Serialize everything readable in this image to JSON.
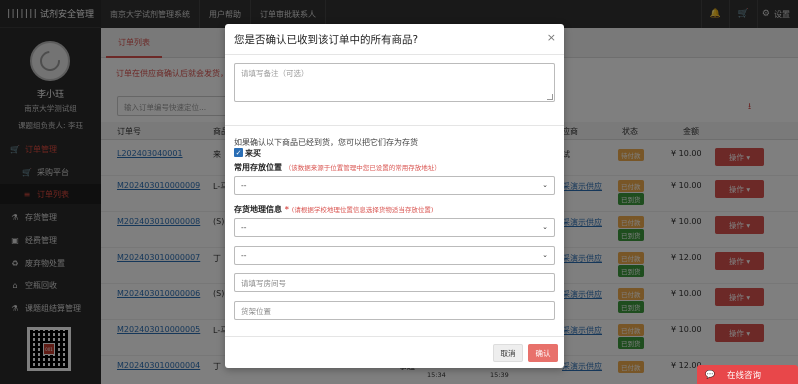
{
  "app": {
    "logo_glyph": "|||||||",
    "title": "试剂安全管理"
  },
  "user": {
    "name": "李小珏",
    "group": "南京大学测试组",
    "role": "课题组负责人: 李珏"
  },
  "sidebar": {
    "items": [
      {
        "icon": "cart-icon",
        "glyph": "🛒",
        "label": "订单管理"
      },
      {
        "icon": "cart-icon",
        "glyph": "🛒",
        "label": "采购平台"
      },
      {
        "icon": "list-icon",
        "glyph": "≡",
        "label": "订单列表"
      },
      {
        "icon": "flask-icon",
        "glyph": "⚗",
        "label": "存货管理"
      },
      {
        "icon": "money-icon",
        "glyph": "▣",
        "label": "经费管理"
      },
      {
        "icon": "recycle-icon",
        "glyph": "♻",
        "label": "废弃物处置"
      },
      {
        "icon": "bottle-icon",
        "glyph": "⌂",
        "label": "空瓶回收"
      },
      {
        "icon": "settle-icon",
        "glyph": "⚗",
        "label": "课题组结算管理"
      }
    ],
    "qr_text": "001"
  },
  "topbar": {
    "nav": [
      "南京大学试剂管理系统",
      "用户帮助",
      "订单审批联系人"
    ],
    "bell_glyph": "🔔",
    "cart_glyph": "🛒",
    "settings_glyph": "⚙",
    "settings_label": "设置"
  },
  "content": {
    "tab": "订单列表",
    "notice": "订单在供应商确认后就会发货，",
    "search_placeholder": "输入订单编号快速定位...",
    "download_glyph": "⭳",
    "headers": {
      "order_no": "订单号",
      "goods": "商品",
      "supplier": "应商",
      "status": "状态",
      "amount": "金额"
    },
    "rows": [
      {
        "order_no": "L202403040001",
        "goods": "来",
        "supplier": "试",
        "badges": [
          "待付款"
        ],
        "amount": "¥ 10.00",
        "op": "操作"
      },
      {
        "order_no": "M202403010000009",
        "goods": "L-马",
        "supplier": "采演示供应",
        "badges": [
          "已付款",
          "已到货"
        ],
        "amount": "¥ 10.00",
        "op": "操作"
      },
      {
        "order_no": "M202403010000008",
        "goods": "(S)",
        "supplier": "采演示供应",
        "badges": [
          "已付款",
          "已到货"
        ],
        "amount": "¥ 10.00",
        "op": "操作"
      },
      {
        "order_no": "M202403010000007",
        "goods": "丁",
        "supplier": "采演示供应",
        "badges": [
          "已付款",
          "已到货"
        ],
        "amount": "¥ 12.00",
        "op": "操作"
      },
      {
        "order_no": "M202403010000006",
        "goods": "(S)",
        "supplier": "采演示供应",
        "badges": [
          "已付款",
          "已到货"
        ],
        "amount": "¥ 10.00",
        "op": "操作"
      },
      {
        "order_no": "M202403010000005",
        "goods": "L-马",
        "supplier": "采演示供应",
        "badges": [
          "已付款",
          "已到货"
        ],
        "amount": "¥ 10.00",
        "op": "操作"
      },
      {
        "order_no": "M202403010000004",
        "goods": "丁",
        "supplier": "采演示供应",
        "badges": [
          "已付款"
        ],
        "amount": "¥ 12.00",
        "op": "操作",
        "times": [
          "15:34",
          "15:39"
        ],
        "sup_prefix": "事超"
      }
    ]
  },
  "modal": {
    "title": "您是否确认已收到该订单中的所有商品?",
    "close_glyph": "×",
    "remark_placeholder": "请填写备注（可选）",
    "hint": "如果确认以下商品已经到货，您可以把它们存为存货",
    "checkbox_label": "来买",
    "location_label": "常用存放位置",
    "location_hint": "（该数据来源于位置管理中您已设置的常用存放地址）",
    "location_value": "--",
    "geo_label": "存货地理信息",
    "geo_required": "*",
    "geo_hint": "(请根据学校地理位置信息选择货物适当存放位置)",
    "geo_select1": "--",
    "geo_select2": "--",
    "room_placeholder": "请填写房间号",
    "shelf_placeholder": "货架位置",
    "cancel": "取消",
    "confirm": "确认"
  },
  "chat": {
    "glyph": "💬",
    "label": "在线咨询"
  }
}
